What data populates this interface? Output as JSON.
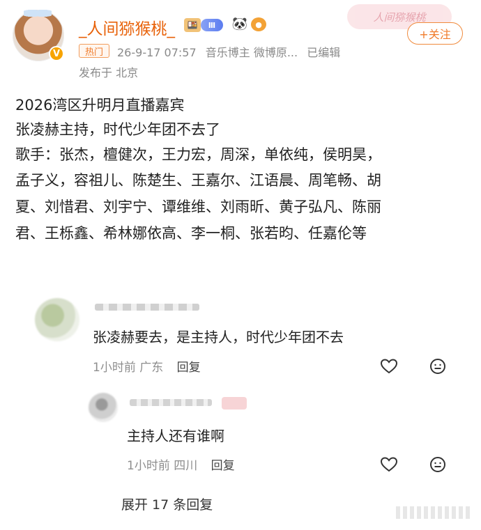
{
  "header": {
    "username": "_人间猕猴桃_",
    "level_badge": "Ⅲ",
    "follow_label": "+关注",
    "watermark_text": "人间猕猴桃",
    "hot_tag": "热门",
    "timestamp": "26-9-17 07:57",
    "source": "音乐博主 微博原...",
    "edited": "已编辑",
    "location": "发布于 北京",
    "accent_color": "#e8620a"
  },
  "post": {
    "lines": [
      "2026湾区升明月直播嘉宾",
      "张凌赫主持，时代少年团不去了",
      "歌手：张杰，檀健次，王力宏，周深，单依纯，侯明昊，",
      "孟子义，容祖儿、陈楚生、王嘉尔、江语晨、周笔畅、胡",
      "夏、刘惜君、刘宇宁、谭维维、刘雨昕、黄子弘凡、陈丽",
      "君、王栎鑫、希林娜依高、李一桐、张若昀、任嘉伦等"
    ]
  },
  "comments": {
    "first": {
      "text": "张凌赫要去，是主持人，时代少年团不去",
      "time": "1小时前",
      "region": "广东",
      "reply_label": "回复"
    },
    "reply": {
      "text": "主持人还有谁啊",
      "time": "1小时前",
      "region": "四川",
      "reply_label": "回复"
    },
    "expand_label": "展开 17 条回复"
  },
  "icons": {
    "heart": "heart-outline-icon",
    "emoji": "emoji-icon",
    "verified": "verified-v-icon"
  }
}
